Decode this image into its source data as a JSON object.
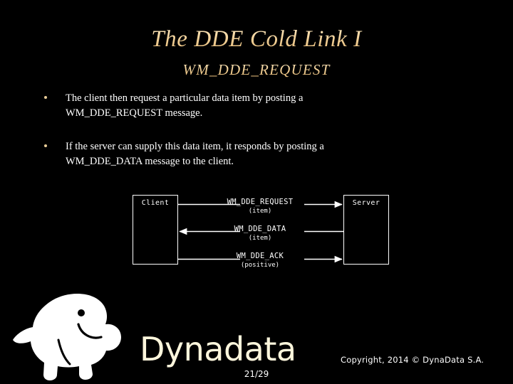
{
  "slide": {
    "background_color": "#000000",
    "title": "The DDE Cold Link I",
    "subtitle": "WM_DDE_REQUEST",
    "title_color": "#f3d7a3"
  },
  "bullets": [
    {
      "marker": "bullet-dot",
      "line1": "The client then request a particular data item by posting a",
      "line2": "WM_DDE_REQUEST message."
    },
    {
      "marker": "bullet-dot",
      "line1": "If the server can supply this data item, it responds by posting a",
      "line2": "WM_DDE_DATA message to the client."
    }
  ],
  "diagram": {
    "client_label": "Client",
    "server_label": "Server",
    "messages": [
      {
        "name": "WM_DDE_REQUEST",
        "arg": "(item)",
        "direction": "right"
      },
      {
        "name": "WM_DDE_DATA",
        "arg": "(item)",
        "direction": "left"
      },
      {
        "name": "WM_DDE_ACK",
        "arg": "(positive)",
        "direction": "right"
      }
    ],
    "line_color": "#ffffff"
  },
  "footer": {
    "brand": "Dynadata",
    "brand_color": "#fdf6dc",
    "page_number": "21/29",
    "copyright": "Copyright, 2014 © Dyna​Data S.A.",
    "logo_name": "manatee-logo"
  }
}
